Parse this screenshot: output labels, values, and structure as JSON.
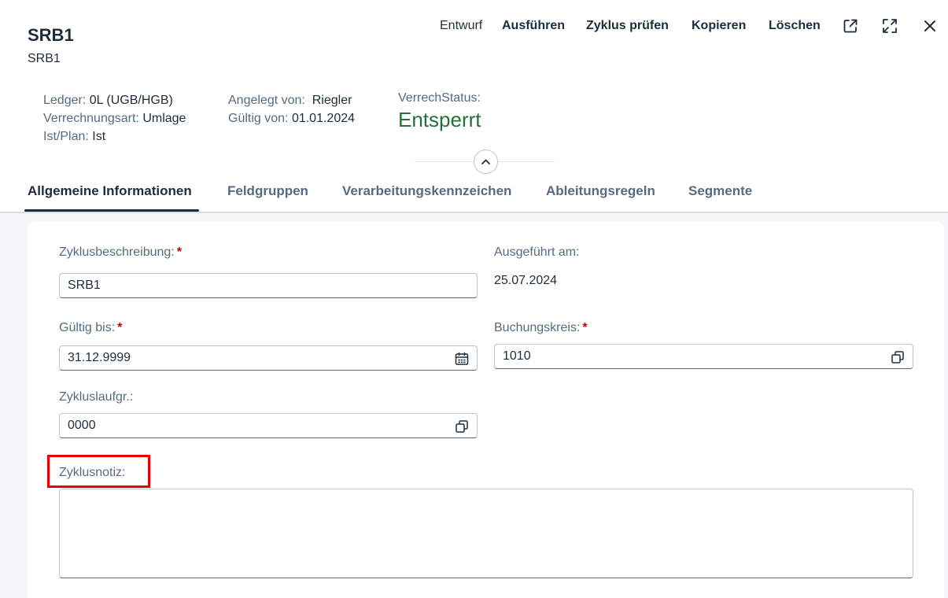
{
  "header": {
    "title": "SRB1",
    "subtitle": "SRB1",
    "toolbar": {
      "draft_label": "Entwurf",
      "execute_label": "Ausführen",
      "check_cycle_label": "Zyklus prüfen",
      "copy_label": "Kopieren",
      "delete_label": "Löschen"
    },
    "attributes": {
      "ledger_label": "Ledger:",
      "ledger_value": "0L (UGB/HGB)",
      "alloc_type_label": "Verrechnungsart:",
      "alloc_type_value": "Umlage",
      "actual_plan_label": "Ist/Plan:",
      "actual_plan_value": "Ist",
      "created_by_label": "Angelegt von:",
      "created_by_value": "Riegler",
      "valid_from_label": "Gültig von:",
      "valid_from_value": "01.01.2024",
      "status_label": "VerrechStatus:",
      "status_value": "Entsperrt"
    }
  },
  "tabs": [
    {
      "label": "Allgemeine Informationen"
    },
    {
      "label": "Feldgruppen"
    },
    {
      "label": "Verarbeitungskennzeichen"
    },
    {
      "label": "Ableitungsregeln"
    },
    {
      "label": "Segmente"
    }
  ],
  "form": {
    "cycle_description_label": "Zyklusbeschreibung:",
    "cycle_description_value": "SRB1",
    "executed_on_label": "Ausgeführt am:",
    "executed_on_value": "25.07.2024",
    "valid_to_label": "Gültig bis:",
    "valid_to_value": "31.12.9999",
    "company_code_label": "Buchungskreis:",
    "company_code_value": "1010",
    "cycle_run_group_label": "Zykluslaufgr.:",
    "cycle_run_group_value": "0000",
    "cycle_note_label": "Zyklusnotiz:",
    "cycle_note_value": "",
    "required_marker": "*"
  },
  "colors": {
    "status_positive": "#256f3a",
    "required": "#aa0808",
    "highlight": "#e8000b"
  },
  "icons": [
    "share-icon",
    "fullscreen-icon",
    "close-icon",
    "collapse-header-icon",
    "calendar-icon",
    "value-help-icon"
  ]
}
